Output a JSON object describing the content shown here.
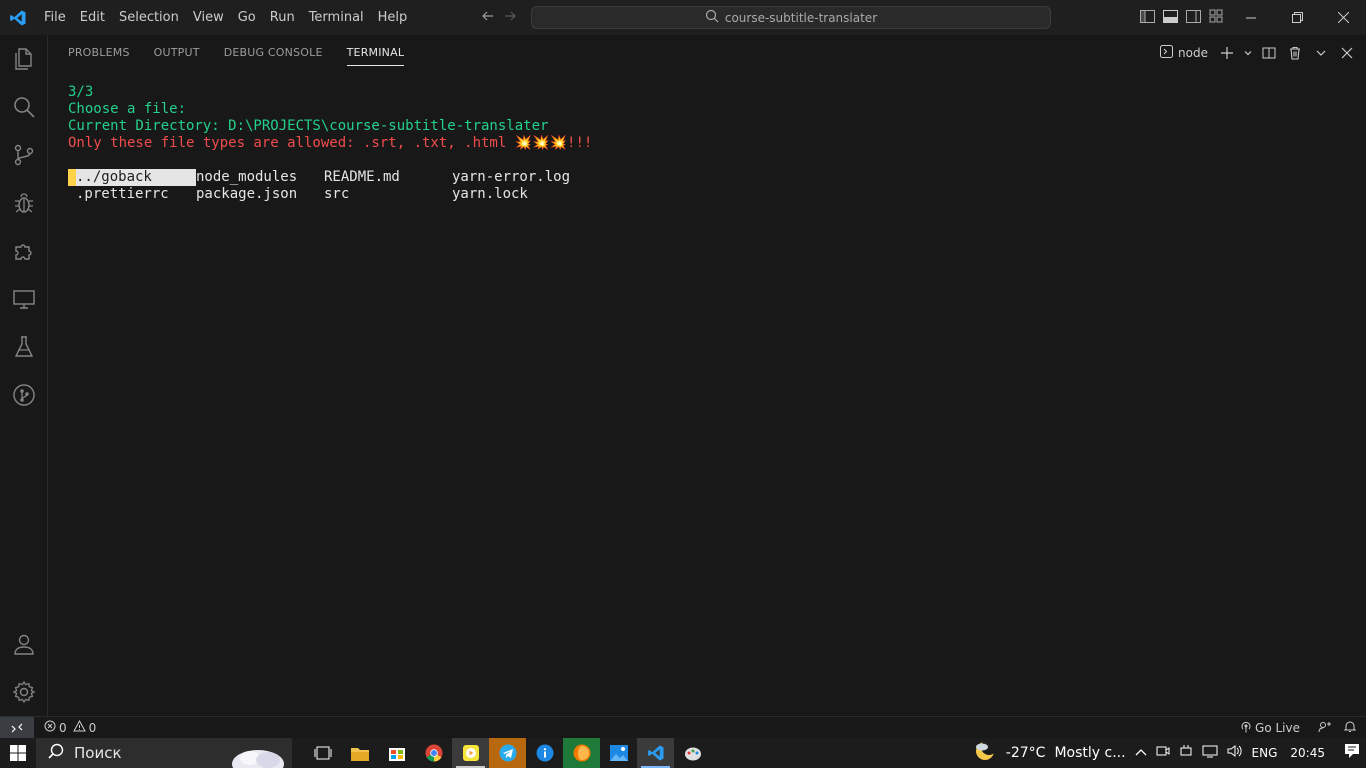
{
  "menu": [
    "File",
    "Edit",
    "Selection",
    "View",
    "Go",
    "Run",
    "Terminal",
    "Help"
  ],
  "search": {
    "text": "course-subtitle-translater"
  },
  "panel": {
    "tabs": [
      "PROBLEMS",
      "OUTPUT",
      "DEBUG CONSOLE",
      "TERMINAL"
    ],
    "active_tab": "TERMINAL",
    "terminal_name": "node"
  },
  "terminal": {
    "progress": "3/3",
    "prompt": "Choose a file:",
    "current_dir": "Current Directory: D:\\PROJECTS\\course-subtitle-translater",
    "warning": "Only these file types are allowed: .srt, .txt, .html 💥💥💥!!!",
    "files": [
      {
        "name": "../goback",
        "selected": true
      },
      {
        "name": "node_modules"
      },
      {
        "name": "README.md"
      },
      {
        "name": "yarn-error.log"
      },
      {
        "name": ".prettierrc"
      },
      {
        "name": "package.json"
      },
      {
        "name": "src"
      },
      {
        "name": "yarn.lock"
      }
    ]
  },
  "statusbar": {
    "errors": "0",
    "warnings": "0",
    "go_live": "Go Live"
  },
  "taskbar": {
    "search_placeholder": "Поиск",
    "weather_temp": "-27°C",
    "weather_desc": "Mostly c...",
    "lang": "ENG",
    "time": "20:45"
  }
}
